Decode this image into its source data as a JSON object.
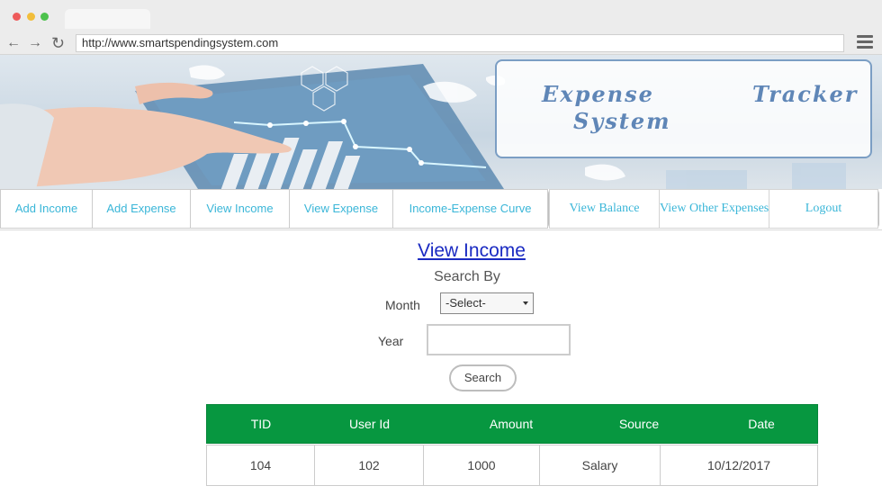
{
  "browser": {
    "url": "http://www.smartspendingsystem.com",
    "back_icon": "arrow-left-icon",
    "forward_icon": "arrow-right-icon",
    "reload_icon": "reload-icon",
    "menu_icon": "hamburger-menu-icon"
  },
  "banner": {
    "title_line1": "Expense   Tracker",
    "title_line2": "System"
  },
  "nav": {
    "items": [
      {
        "label": "Add Income"
      },
      {
        "label": "Add Expense"
      },
      {
        "label": "View Income"
      },
      {
        "label": "View Expense"
      },
      {
        "label": "Income-Expense Curve"
      },
      {
        "label": "View Balance"
      },
      {
        "label": "View Other Expenses"
      },
      {
        "label": "Logout"
      }
    ]
  },
  "main": {
    "title": "View Income",
    "search_by": "Search By",
    "month_label": "Month",
    "month_selected": "-Select-",
    "year_label": "Year",
    "year_value": "",
    "search_button": "Search"
  },
  "table": {
    "headers": [
      "TID",
      "User Id",
      "Amount",
      "Source",
      "Date"
    ],
    "rows": [
      [
        "104",
        "102",
        "1000",
        "Salary",
        "10/12/2017"
      ]
    ]
  },
  "colors": {
    "nav_text": "#3ab6d8",
    "title_link": "#1a2ac2",
    "table_header": "#079740",
    "banner_title": "#5f86b7"
  }
}
